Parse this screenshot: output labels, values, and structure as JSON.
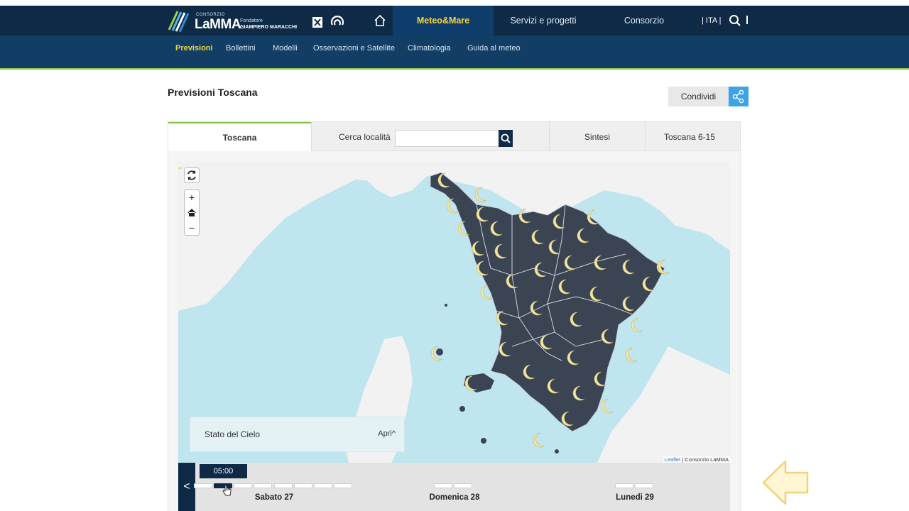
{
  "header": {
    "logo": {
      "small": "CONSORZIO",
      "name": "LaMMA",
      "founder_label": "Fondatore",
      "founder_name": "GIAMPIERO MARACCHI"
    },
    "nav": [
      {
        "label": "Meteo&Mare",
        "active": true
      },
      {
        "label": "Servizi e progetti",
        "active": false
      },
      {
        "label": "Consorzio",
        "active": false
      }
    ],
    "lang": "ITA"
  },
  "subnav": [
    {
      "label": "Previsioni",
      "active": true
    },
    {
      "label": "Bollettini",
      "active": false
    },
    {
      "label": "Modelli",
      "active": false
    },
    {
      "label": "Osservazioni e Satellite",
      "active": false
    },
    {
      "label": "Climatologia",
      "active": false
    },
    {
      "label": "Guida al meteo",
      "active": false
    }
  ],
  "page": {
    "title": "Previsioni Toscana",
    "share_label": "Condividi"
  },
  "tabs": {
    "toscana": "Toscana",
    "search_label": "Cerca località",
    "search_value": "",
    "sintesi": "Sintesi",
    "toscana615": "Toscana 6-15"
  },
  "map": {
    "legend_title": "Stato del Cielo",
    "legend_toggle": "Apri^",
    "attribution_link": "Leaflet",
    "attribution_text": " | Consorzio LaMMA",
    "controls": {
      "zoom_in": "+",
      "zoom_out": "−"
    },
    "colors": {
      "sea": "#bfe5ef",
      "land": "#3a4452",
      "outside_land": "#f2f2f2",
      "moon": "#f2e6a6"
    },
    "weather_icon": "moon-icon"
  },
  "timeline": {
    "prev": "<",
    "current_time": "05:00",
    "days": [
      {
        "label": "Sabato 27"
      },
      {
        "label": "Domenica 28"
      },
      {
        "label": "Lunedi 29"
      }
    ],
    "selected_slot": 1
  }
}
